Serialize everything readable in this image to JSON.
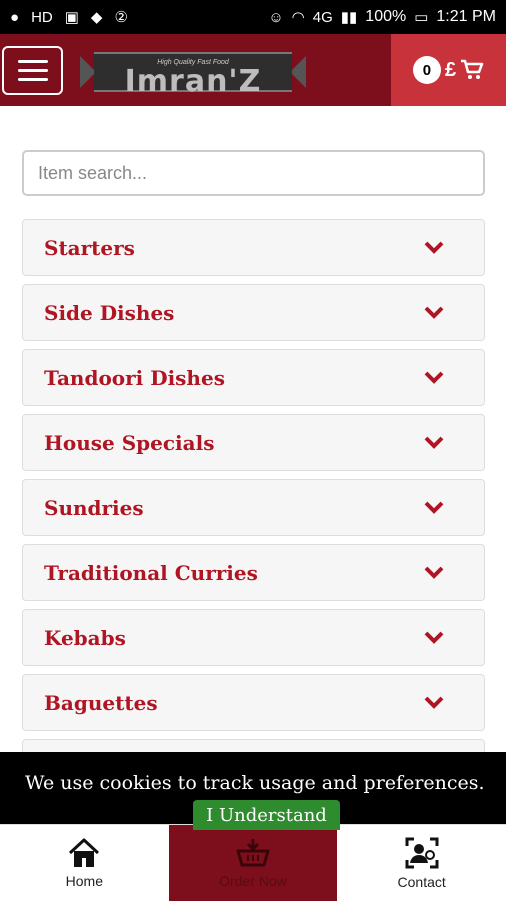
{
  "status_bar": {
    "battery": "100%",
    "time": "1:21 PM",
    "network": "4G",
    "left_icons": [
      "chat-icon",
      "hd-icon",
      "image-icon",
      "android-icon",
      "sync-icon"
    ]
  },
  "header": {
    "logo_tagline": "High Quality Fast Food",
    "logo_name": "Imran'Z",
    "cart_count": "0",
    "currency": "£"
  },
  "search": {
    "placeholder": "Item search..."
  },
  "categories": [
    {
      "label": "Starters"
    },
    {
      "label": "Side Dishes"
    },
    {
      "label": "Tandoori Dishes"
    },
    {
      "label": "House Specials"
    },
    {
      "label": "Sundries"
    },
    {
      "label": "Traditional Curries"
    },
    {
      "label": "Kebabs"
    },
    {
      "label": "Baguettes"
    }
  ],
  "cookie": {
    "message": "We use cookies to track usage and preferences.",
    "button": "I Understand"
  },
  "bottom_nav": [
    {
      "label": "Home",
      "icon": "home-icon"
    },
    {
      "label": "Order Now",
      "icon": "basket-icon"
    },
    {
      "label": "Contact",
      "icon": "contact-icon"
    }
  ],
  "colors": {
    "brand_dark": "#7d0f1d",
    "brand_light": "#c8323a",
    "category_text": "#b01523",
    "accept_green": "#2e8b2e"
  }
}
